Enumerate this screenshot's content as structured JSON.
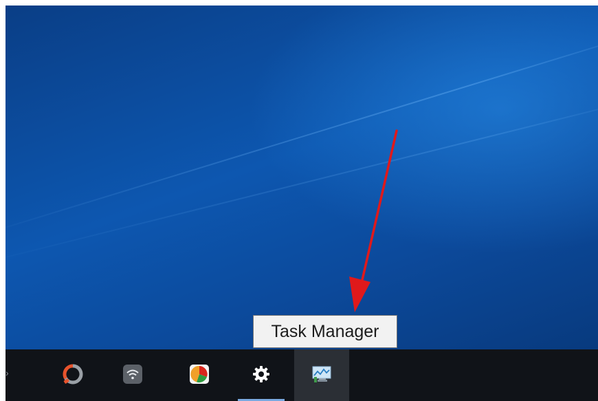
{
  "tooltip": {
    "text": "Task Manager"
  },
  "taskbar": {
    "buttons": [
      {
        "name": "avast-cleanup-app",
        "icon": "cleanup-ring-icon",
        "active": false,
        "hovered": false
      },
      {
        "name": "wifi-app",
        "icon": "wifi-icon",
        "active": false,
        "hovered": false
      },
      {
        "name": "pie-app",
        "icon": "pie-chart-icon",
        "active": false,
        "hovered": false
      },
      {
        "name": "settings-app",
        "icon": "gear-icon",
        "active": true,
        "hovered": false
      },
      {
        "name": "task-manager-app",
        "icon": "task-manager-icon",
        "active": false,
        "hovered": true
      }
    ]
  },
  "annotation": {
    "arrow_color": "#e0191b"
  },
  "colors": {
    "desktop_dark": "#0a3e86",
    "desktop_light": "#1c7fd8",
    "taskbar": "#101318",
    "active_indicator": "#7aa9e0"
  }
}
